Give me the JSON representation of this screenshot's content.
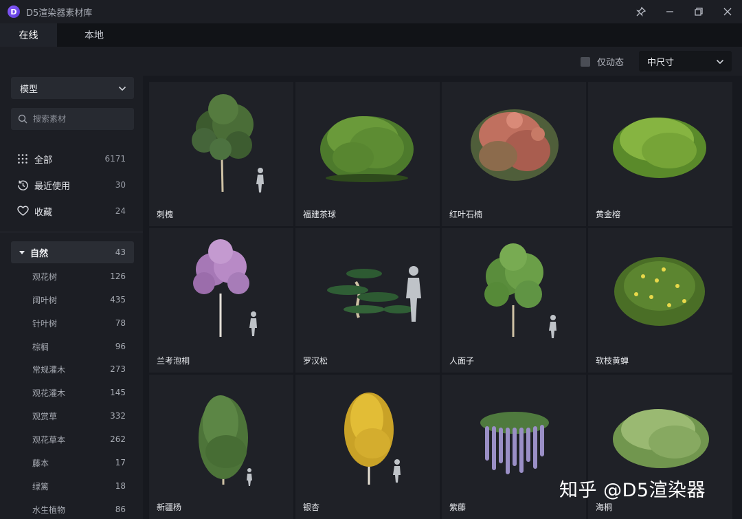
{
  "app": {
    "title": "D5渲染器素材库",
    "logo_letter": "D"
  },
  "tabs": [
    {
      "label": "在线"
    },
    {
      "label": "本地"
    }
  ],
  "filters": {
    "only_dynamic_label": "仅动态",
    "only_dynamic_checked": false,
    "size_selected": "中尺寸"
  },
  "sidebar": {
    "type_selected": "模型",
    "search_placeholder": "搜索素材",
    "quick": [
      {
        "label": "全部",
        "count": "6171",
        "icon": "grid-dots-icon"
      },
      {
        "label": "最近使用",
        "count": "30",
        "icon": "history-icon"
      },
      {
        "label": "收藏",
        "count": "24",
        "icon": "heart-icon"
      }
    ],
    "category": {
      "label": "自然",
      "count": "43",
      "expanded": true
    },
    "subcategories": [
      {
        "label": "观花树",
        "count": "126"
      },
      {
        "label": "阔叶树",
        "count": "435"
      },
      {
        "label": "针叶树",
        "count": "78"
      },
      {
        "label": "棕榈",
        "count": "96"
      },
      {
        "label": "常规灌木",
        "count": "273"
      },
      {
        "label": "观花灌木",
        "count": "145"
      },
      {
        "label": "观赏草",
        "count": "332"
      },
      {
        "label": "观花草本",
        "count": "262"
      },
      {
        "label": "藤本",
        "count": "17"
      },
      {
        "label": "绿篱",
        "count": "18"
      },
      {
        "label": "水生植物",
        "count": "86"
      }
    ]
  },
  "assets": [
    {
      "name": "刺槐"
    },
    {
      "name": "福建茶球"
    },
    {
      "name": "红叶石楠"
    },
    {
      "name": "黄金榕"
    },
    {
      "name": "兰考泡桐"
    },
    {
      "name": "罗汉松"
    },
    {
      "name": "人面子"
    },
    {
      "name": "软枝黄蝉"
    },
    {
      "name": "新疆杨"
    },
    {
      "name": "银杏"
    },
    {
      "name": "紫藤"
    },
    {
      "name": "海桐"
    }
  ],
  "watermark": "知乎 @D5渲染器",
  "colors": {
    "accent": "#7b4dff",
    "background": "#17191f",
    "panel": "#1c1e24",
    "card": "#1f2127"
  }
}
